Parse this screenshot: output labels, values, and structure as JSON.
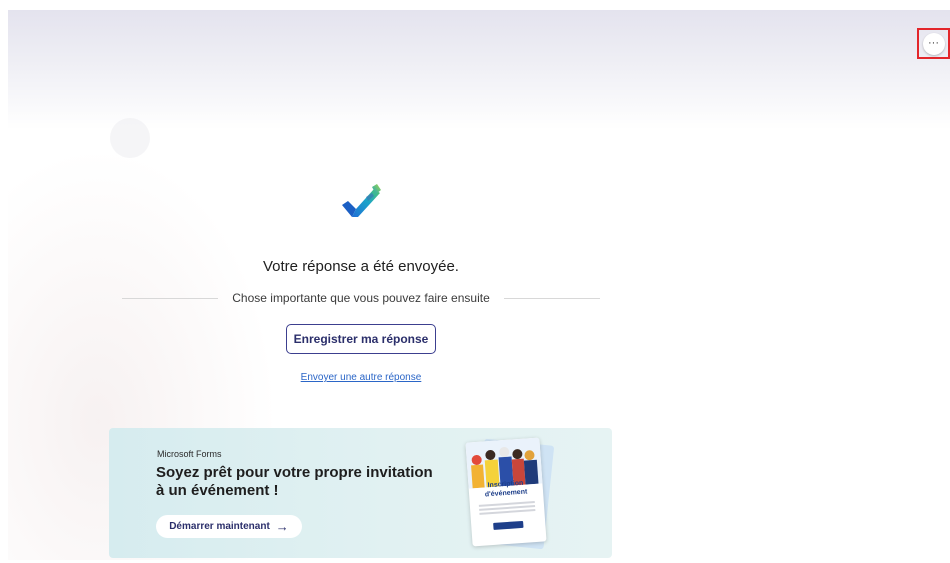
{
  "header": {
    "more_icon": "ellipsis-icon",
    "more_label": "···"
  },
  "confirmation": {
    "icon": "checkmark-icon",
    "title": "Votre réponse a été envoyée.",
    "next_steps_label": "Chose importante que vous pouvez faire ensuite",
    "save_button_label": "Enregistrer ma réponse",
    "another_response_link": "Envoyer une autre réponse"
  },
  "promo": {
    "eyebrow": "Microsoft Forms",
    "title": "Soyez prêt pour votre propre invitation à un événement !",
    "button_label": "Démarrer maintenant",
    "button_arrow": "→",
    "flyer_title": "Inscription d'événement"
  },
  "colors": {
    "accent": "#2b2f6b",
    "link": "#2b66c7",
    "highlight_border": "#e3262b",
    "promo_bg": "#d6ecef"
  }
}
